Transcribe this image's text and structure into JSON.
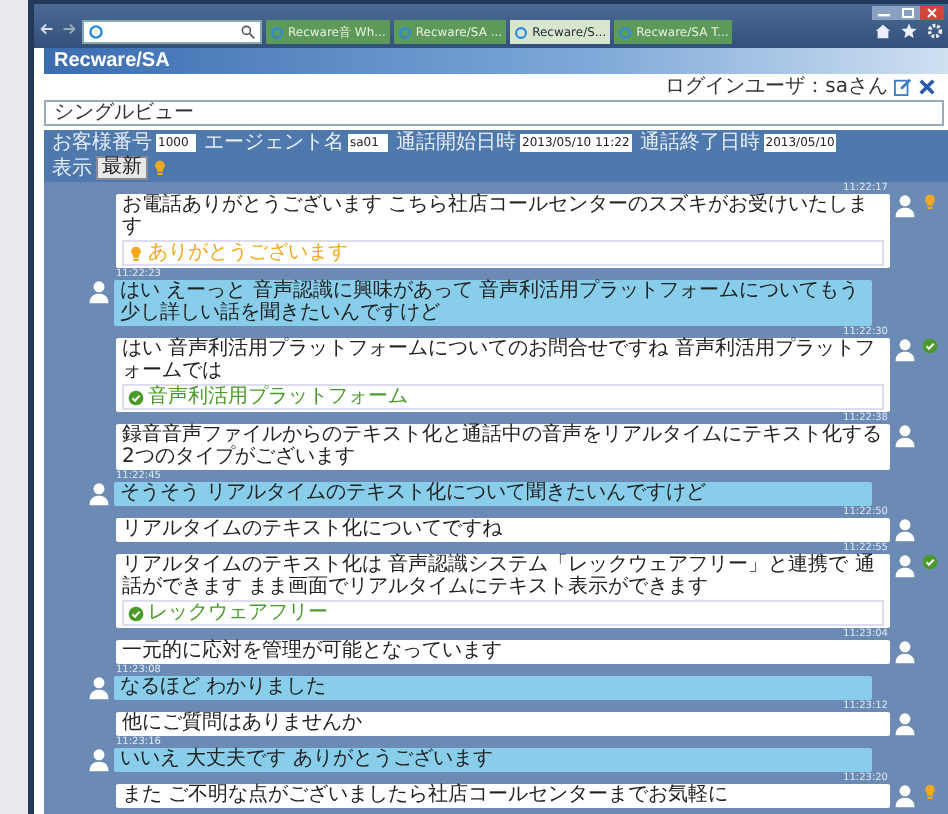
{
  "browser": {
    "tabs": [
      {
        "label": "Recware音 Wh...",
        "selected": false
      },
      {
        "label": "Recware/SA ...",
        "selected": false
      },
      {
        "label": "Recware/S...",
        "selected": true
      },
      {
        "label": "Recware/SA T...",
        "selected": false
      }
    ]
  },
  "app": {
    "title": "Recware/SA",
    "login_user": "ログインユーザ：saさん",
    "view_title": "シングルビュー"
  },
  "filters": [
    {
      "label": "お客様番号",
      "value": "1000"
    },
    {
      "label": "エージェント名",
      "value": "sa01"
    },
    {
      "label": "通話開始日時",
      "value": "2013/05/10 11:22"
    },
    {
      "label": "通話終了日時",
      "value": "2013/05/10"
    }
  ],
  "display": {
    "label": "表示",
    "value": "最新"
  },
  "messages": [
    {
      "kind": "operator",
      "time": "11:22:17",
      "text": "お電話ありがとうございます こちら社店コールセンターのスズキがお受けいたします",
      "hint": {
        "kind": "bulb",
        "text": "ありがとうございます"
      }
    },
    {
      "kind": "customer",
      "time": "11:22:23",
      "text": "はい えーっと 音声認識に興味があって 音声利活用プラットフォームについてもう少し詳しい話を聞きたいんですけど"
    },
    {
      "kind": "operator",
      "time": "11:22:30",
      "text": "はい 音声利活用プラットフォームについてのお問合せですね 音声利活用プラットフォームでは",
      "hint": {
        "kind": "check",
        "text": "音声利活用プラットフォーム"
      }
    },
    {
      "kind": "operator",
      "time": "11:22:38",
      "text": "録音音声ファイルからのテキスト化と通話中の音声をリアルタイムにテキスト化する2つのタイプがございます"
    },
    {
      "kind": "customer",
      "time": "11:22:45",
      "text": "そうそう リアルタイムのテキスト化について聞きたいんですけど"
    },
    {
      "kind": "operator",
      "time": "11:22:50",
      "text": "リアルタイムのテキスト化についてですね"
    },
    {
      "kind": "operator",
      "time": "11:22:55",
      "text": "リアルタイムのテキスト化は 音声認識システム「レックウェアフリー」と連携で 通話ができます まま画面でリアルタイムにテキスト表示ができます",
      "hint": {
        "kind": "check",
        "text": "レックウェアフリー"
      }
    },
    {
      "kind": "operator",
      "time": "11:23:04",
      "text": "一元的に応対を管理が可能となっています"
    },
    {
      "kind": "customer",
      "time": "11:23:08",
      "text": "なるほど わかりました"
    },
    {
      "kind": "operator",
      "time": "11:23:12",
      "text": "他にご質問はありませんか"
    },
    {
      "kind": "customer",
      "time": "11:23:16",
      "text": "いいえ 大丈夫です ありがとうございます"
    },
    {
      "kind": "operator",
      "time": "11:23:20",
      "text": "また ご不明な点がございましたら社店コールセンターまでお気軽に",
      "side_icon": {
        "kind": "bulb"
      }
    }
  ]
}
